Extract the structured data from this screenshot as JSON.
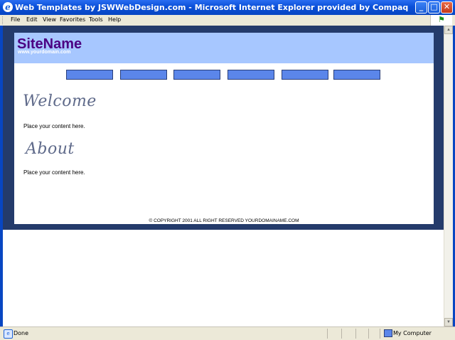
{
  "window": {
    "title": "Web Templates by JSWWebDesign.com - Microsoft Internet Explorer provided by Compaq",
    "minimize": "_",
    "maximize": "□",
    "close": "✕",
    "browser_icon": "ie-icon"
  },
  "menubar": {
    "items": [
      "File",
      "Edit",
      "View",
      "Favorites",
      "Tools",
      "Help"
    ]
  },
  "site": {
    "name": "SiteName",
    "url": "www.yourdomain.com",
    "nav_buttons": [
      "",
      "",
      "",
      "",
      "",
      ""
    ],
    "welcome_heading": "Welcome",
    "welcome_text": "Place your content here.",
    "about_heading": "About",
    "about_text": "Place your content here.",
    "footer": "© COPYRIGHT 2001 ALL RIGHT RESERVED YOURDOMAINAME.COM"
  },
  "statusbar": {
    "status": "Done",
    "zone": "My Computer"
  },
  "colors": {
    "page_background": "#243b6b",
    "header": "#a7c7ff",
    "sitename": "#4b0082",
    "nav_button": "#5b86ea"
  }
}
